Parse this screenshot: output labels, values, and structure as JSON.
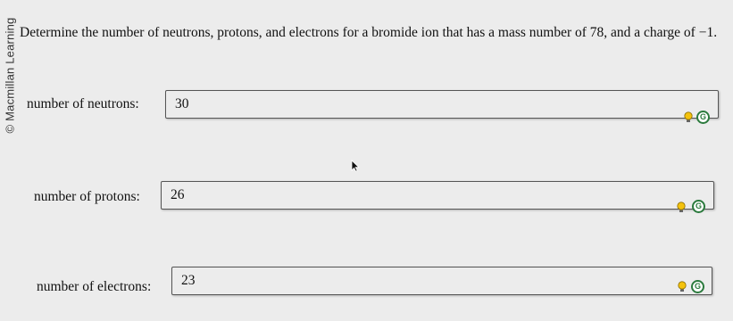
{
  "watermark": "© Macmillan Learning",
  "question": "Determine the number of neutrons, protons, and electrons for a bromide ion that has a mass number of 78, and a charge of −1.",
  "fields": [
    {
      "label": "number of neutrons:",
      "value": "30"
    },
    {
      "label": "number of protons:",
      "value": "26"
    },
    {
      "label": "number of electrons:",
      "value": "23"
    }
  ],
  "icons": {
    "hint": "lightbulb-icon",
    "check": "check-answer-icon",
    "check_glyph": "G",
    "cursor": "mouse-cursor-icon"
  },
  "colors": {
    "background": "#ececec",
    "hint_yellow": "#f4c20d",
    "check_green": "#2b7a3d"
  }
}
